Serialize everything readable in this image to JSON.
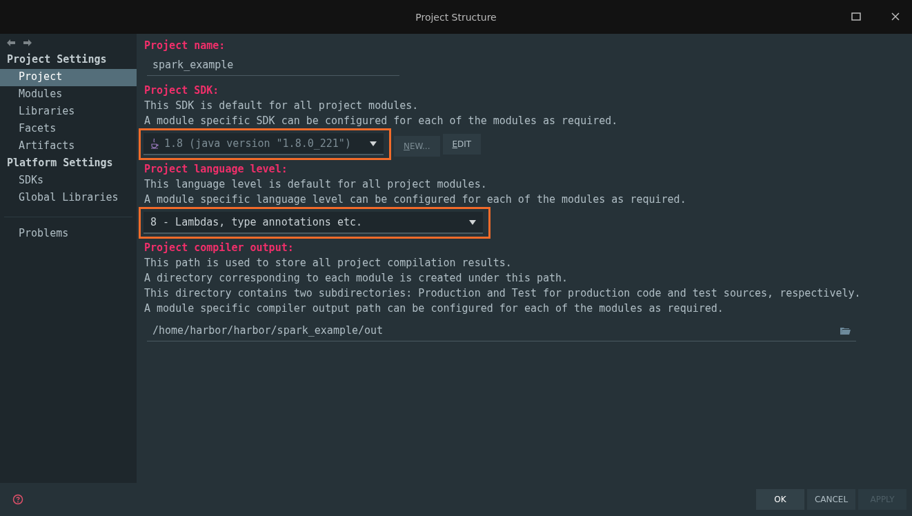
{
  "window": {
    "title": "Project Structure"
  },
  "sidebar": {
    "sections": [
      {
        "title": "Project Settings",
        "items": [
          {
            "label": "Project",
            "selected": true
          },
          {
            "label": "Modules",
            "selected": false
          },
          {
            "label": "Libraries",
            "selected": false
          },
          {
            "label": "Facets",
            "selected": false
          },
          {
            "label": "Artifacts",
            "selected": false
          }
        ]
      },
      {
        "title": "Platform Settings",
        "items": [
          {
            "label": "SDKs",
            "selected": false
          },
          {
            "label": "Global Libraries",
            "selected": false
          }
        ]
      }
    ],
    "bottom_items": [
      {
        "label": "Problems",
        "selected": false
      }
    ]
  },
  "project_name": {
    "label": "Project name:",
    "value": "spark_example"
  },
  "project_sdk": {
    "label": "Project SDK:",
    "lines": [
      "This SDK is default for all project modules.",
      "A module specific SDK can be configured for each of the modules as required."
    ],
    "dropdown": {
      "value": "1.8 (java version \"1.8.0_221\")",
      "highlighted": true
    },
    "buttons": [
      {
        "label": "NEW...",
        "disabled": true
      },
      {
        "label": "EDIT",
        "disabled": false
      }
    ]
  },
  "language_level": {
    "label": "Project language level:",
    "lines": [
      "This language level is default for all project modules.",
      "A module specific language level can be configured for each of the modules as required."
    ],
    "dropdown": {
      "value": "8 - Lambdas, type annotations etc.",
      "highlighted": true
    }
  },
  "compiler_output": {
    "label": "Project compiler output:",
    "lines": [
      "This path is used to store all project compilation results.",
      "A directory corresponding to each module is created under this path.",
      "This directory contains two subdirectories: Production and Test for production code and test sources, respectively.",
      "A module specific compiler output path can be configured for each of the modules as required."
    ],
    "value": "/home/harbor/harbor/spark_example/out"
  },
  "footer_buttons": [
    {
      "label": "OK",
      "default": true,
      "disabled": false
    },
    {
      "label": "CANCEL",
      "default": false,
      "disabled": false
    },
    {
      "label": "APPLY",
      "default": false,
      "disabled": true
    }
  ]
}
